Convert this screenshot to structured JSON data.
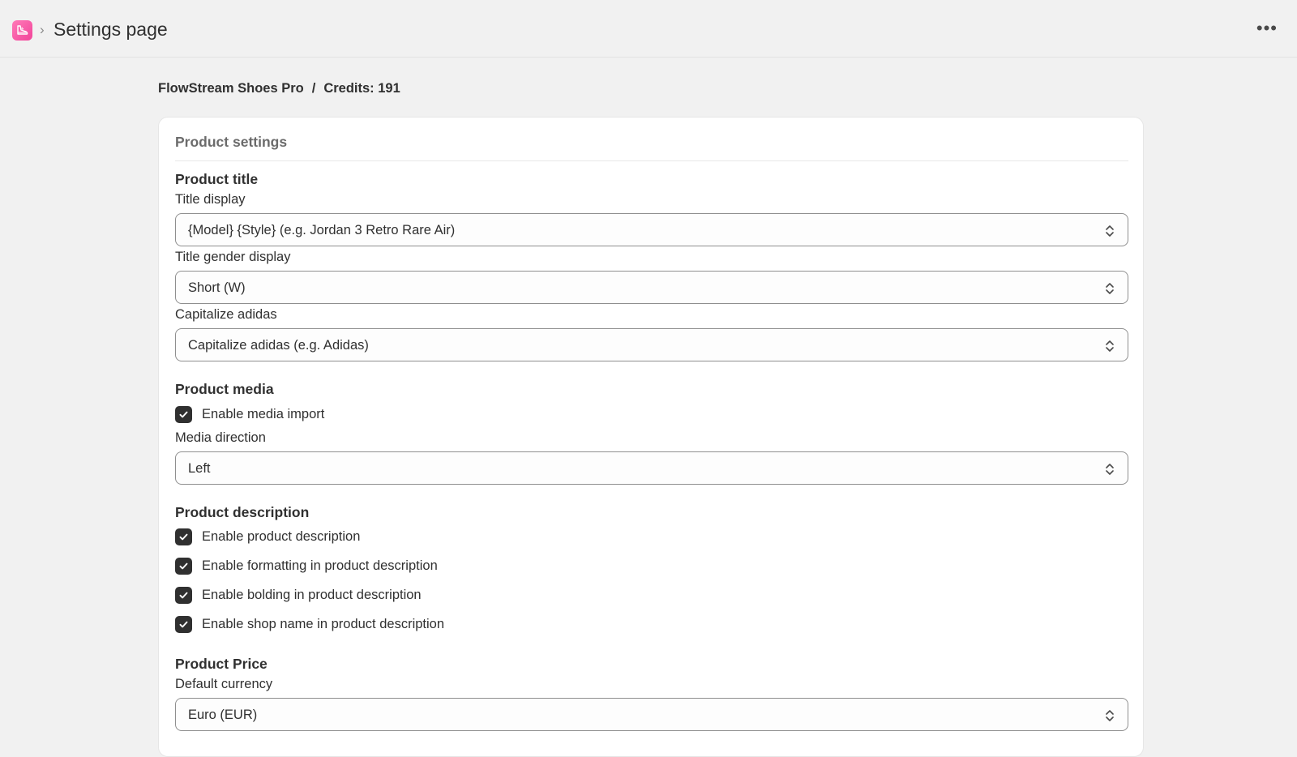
{
  "header": {
    "page_title": "Settings page",
    "app_icon": "shoe-icon",
    "more_icon": "more-horizontal-icon",
    "brand_color": "#f2449a"
  },
  "breadcrumb": {
    "shop": "FlowStream Shoes Pro",
    "separator": "/",
    "credits": "Credits: 191"
  },
  "card": {
    "title": "Product settings",
    "product_title": {
      "heading": "Product title",
      "title_display": {
        "label": "Title display",
        "value": "{Model} {Style} (e.g. Jordan 3 Retro Rare Air)"
      },
      "title_gender_display": {
        "label": "Title gender display",
        "value": "Short (W)"
      },
      "capitalize_adidas": {
        "label": "Capitalize adidas",
        "value": "Capitalize adidas (e.g. Adidas)"
      }
    },
    "product_media": {
      "heading": "Product media",
      "enable_media_import": {
        "label": "Enable media import",
        "checked": true
      },
      "media_direction": {
        "label": "Media direction",
        "value": "Left"
      }
    },
    "product_description": {
      "heading": "Product description",
      "options": [
        {
          "label": "Enable product description",
          "checked": true
        },
        {
          "label": "Enable formatting in product description",
          "checked": true
        },
        {
          "label": "Enable bolding in product description",
          "checked": true
        },
        {
          "label": "Enable shop name in product description",
          "checked": true
        }
      ]
    },
    "product_price": {
      "heading": "Product Price",
      "default_currency": {
        "label": "Default currency",
        "value": "Euro (EUR)"
      }
    }
  }
}
